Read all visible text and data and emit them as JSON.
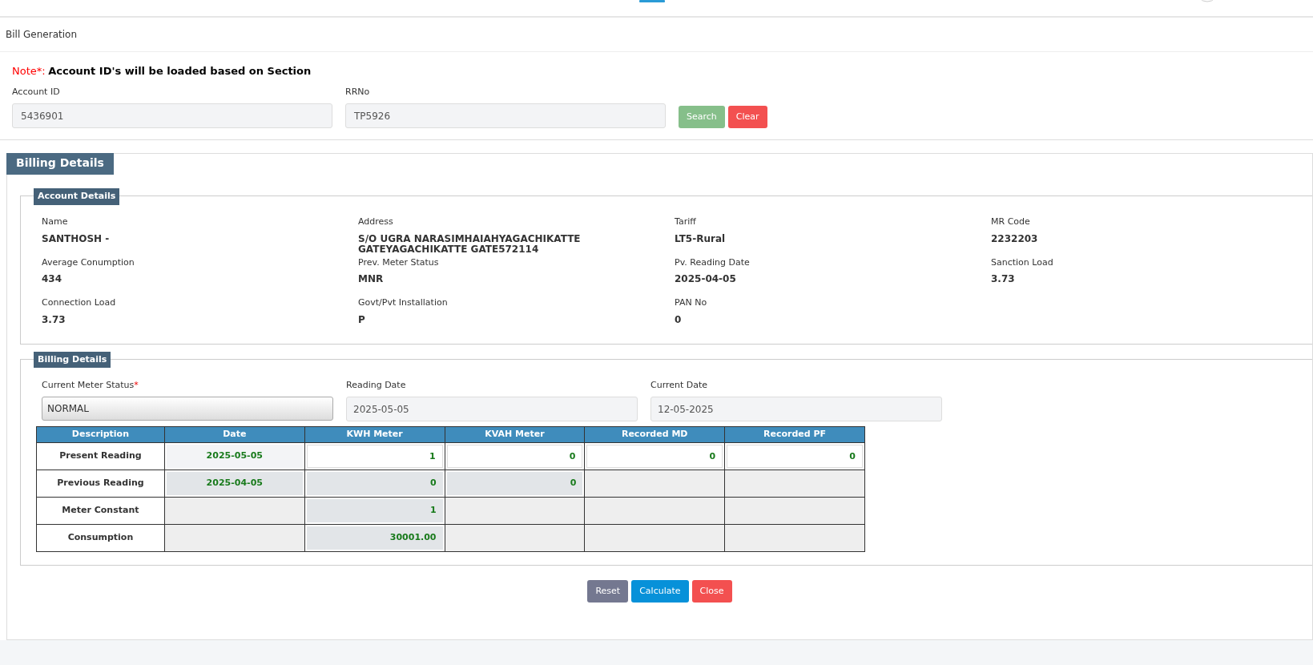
{
  "page_title": "Bill Generation",
  "note": {
    "prefix": "Note*:",
    "text": "Account ID's will be loaded based on Section"
  },
  "search_form": {
    "fields": [
      {
        "label": "Account ID",
        "value": "5436901"
      },
      {
        "label": "RRNo",
        "value": "TP5926"
      }
    ],
    "buttons": [
      {
        "label": "Search",
        "kind": "success"
      },
      {
        "label": "Clear",
        "kind": "danger"
      }
    ]
  },
  "billing_panel": {
    "title": "Billing Details",
    "account_details": {
      "title": "Account Details",
      "items": [
        {
          "label": "Name",
          "value": "SANTHOSH -"
        },
        {
          "label": "Address",
          "value": "S/O UGRA NARASIMHAIAHYAGACHIKATTE GATEYAGACHIKATTE GATE572114"
        },
        {
          "label": "Tariff",
          "value": "LT5-Rural"
        },
        {
          "label": "MR Code",
          "value": "2232203"
        },
        {
          "label": "Average Conumption",
          "value": "434"
        },
        {
          "label": "Prev. Meter Status",
          "value": "MNR"
        },
        {
          "label": "Pv. Reading Date",
          "value": "2025-04-05"
        },
        {
          "label": "Sanction Load",
          "value": "3.73"
        },
        {
          "label": "Connection Load",
          "value": "3.73"
        },
        {
          "label": "Govt/Pvt Installation",
          "value": "P"
        },
        {
          "label": "PAN No",
          "value": "0"
        }
      ]
    },
    "billing_details": {
      "title": "Billing Details",
      "fields": [
        {
          "label": "Current Meter Status",
          "required_mark": "*",
          "kind": "select",
          "value": "NORMAL"
        },
        {
          "label": "Reading Date",
          "kind": "readonly",
          "value": "2025-05-05"
        },
        {
          "label": "Current Date",
          "kind": "readonly",
          "value": "12-05-2025"
        }
      ],
      "table": {
        "columns": [
          "Description",
          "Date",
          "KWH Meter",
          "KVAH Meter",
          "Recorded MD",
          "Recorded PF"
        ],
        "rows": [
          {
            "cells": [
              {
                "kind": "label",
                "value": "Present Reading"
              },
              {
                "kind": "light",
                "value": "2025-05-05"
              },
              {
                "kind": "input",
                "value": "1"
              },
              {
                "kind": "input",
                "value": "0"
              },
              {
                "kind": "input",
                "value": "0"
              },
              {
                "kind": "input",
                "value": "0"
              }
            ]
          },
          {
            "cells": [
              {
                "kind": "label",
                "value": "Previous Reading"
              },
              {
                "kind": "readonly",
                "value": "2025-04-05"
              },
              {
                "kind": "readonly",
                "value": "0"
              },
              {
                "kind": "readonly",
                "value": "0"
              },
              {
                "kind": "blank"
              },
              {
                "kind": "blank"
              }
            ]
          },
          {
            "cells": [
              {
                "kind": "label",
                "value": "Meter Constant"
              },
              {
                "kind": "blank"
              },
              {
                "kind": "readonly",
                "value": "1"
              },
              {
                "kind": "blank"
              },
              {
                "kind": "blank"
              },
              {
                "kind": "blank"
              }
            ]
          },
          {
            "cells": [
              {
                "kind": "label",
                "value": "Consumption"
              },
              {
                "kind": "blank"
              },
              {
                "kind": "readonly",
                "value": "30001.00"
              },
              {
                "kind": "blank"
              },
              {
                "kind": "blank"
              },
              {
                "kind": "blank"
              }
            ]
          }
        ]
      }
    },
    "buttons": [
      {
        "label": "Reset",
        "kind": "secondary"
      },
      {
        "label": "Calculate",
        "kind": "primary"
      },
      {
        "label": "Close",
        "kind": "danger"
      }
    ]
  }
}
